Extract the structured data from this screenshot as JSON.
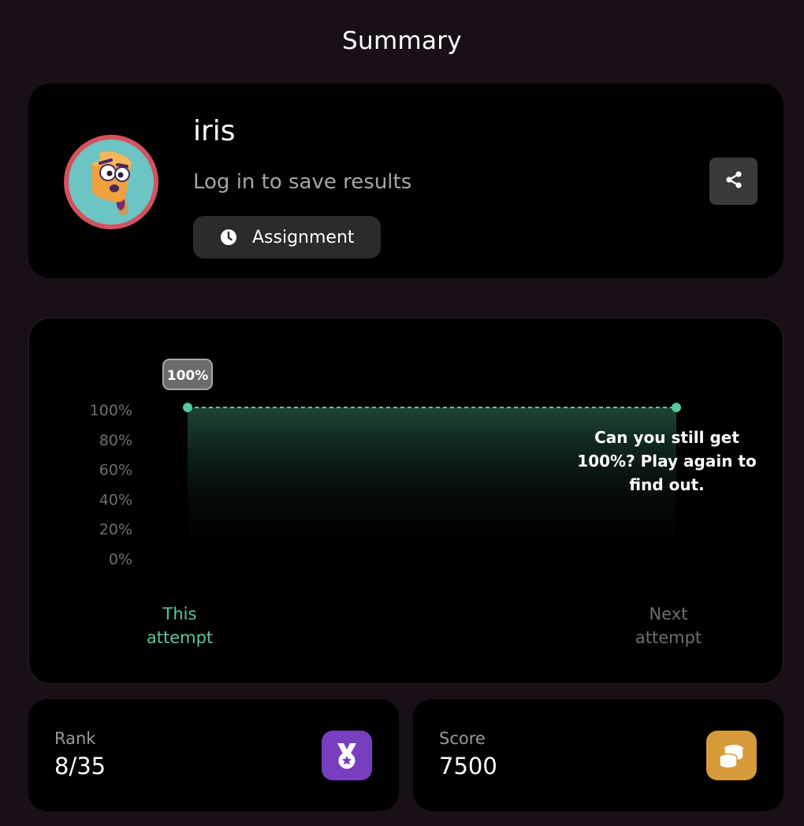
{
  "page": {
    "title": "Summary"
  },
  "player": {
    "name": "iris",
    "login_prompt": "Log in to save results",
    "mode_label": "Assignment",
    "avatar_icon": "popsicle-avatar-icon",
    "share_icon": "share-icon"
  },
  "chart_data": {
    "type": "area",
    "categories": [
      "This attempt",
      "Next attempt"
    ],
    "categories_display": [
      [
        "This",
        "attempt"
      ],
      [
        "Next",
        "attempt"
      ]
    ],
    "values": [
      100,
      100
    ],
    "ylim": [
      0,
      100
    ],
    "yticks": [
      100,
      80,
      60,
      40,
      20,
      0
    ],
    "yticks_labels": [
      "100%",
      "80%",
      "60%",
      "40%",
      "20%",
      "0%"
    ],
    "point_label": "100%",
    "line_style": "dashed",
    "line_color": "#58c99a",
    "message": "Can you still get 100%? Play again to find out."
  },
  "stats": {
    "rank": {
      "label": "Rank",
      "value": "8/35",
      "icon": "medal-icon",
      "color": "#7a3fc0"
    },
    "score": {
      "label": "Score",
      "value": "7500",
      "icon": "coins-icon",
      "color": "#d69a3a"
    }
  }
}
